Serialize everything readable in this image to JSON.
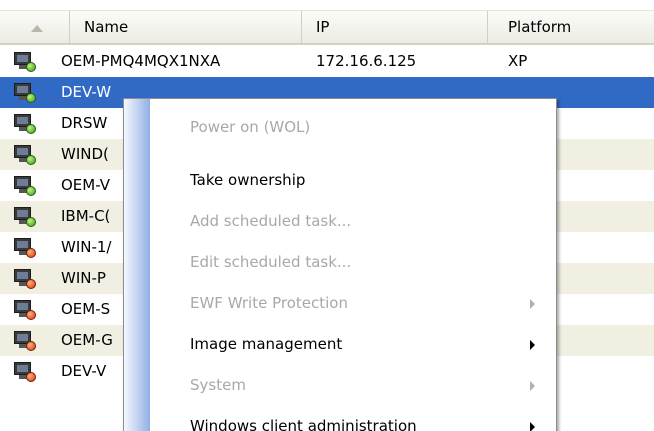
{
  "columns": {
    "name": "Name",
    "ip": "IP",
    "platform": "Platform"
  },
  "rows": [
    {
      "name": "OEM-PMQ4MQX1NXA",
      "ip": "172.16.6.125",
      "platform": "XP",
      "status": "green",
      "selected": false
    },
    {
      "name": "DEV-W",
      "ip": "",
      "platform": "",
      "status": "green",
      "selected": true
    },
    {
      "name": "DRSW",
      "ip": "",
      "platform": "",
      "status": "green",
      "selected": false
    },
    {
      "name": "WIND(",
      "ip": "",
      "platform": "",
      "status": "green",
      "selected": false
    },
    {
      "name": "OEM-V",
      "ip": "",
      "platform": "",
      "status": "green",
      "selected": false
    },
    {
      "name": "IBM-C(",
      "ip": "",
      "platform": "",
      "status": "green",
      "selected": false
    },
    {
      "name": "WIN-1/",
      "ip": "",
      "platform": "",
      "status": "red",
      "selected": false
    },
    {
      "name": "WIN-P",
      "ip": "",
      "platform": "",
      "status": "red",
      "selected": false
    },
    {
      "name": "OEM-S",
      "ip": "",
      "platform": "",
      "status": "red",
      "selected": false
    },
    {
      "name": "OEM-G",
      "ip": "",
      "platform": "",
      "status": "red",
      "selected": false
    },
    {
      "name": "DEV-V",
      "ip": "",
      "platform": "",
      "status": "red",
      "selected": false
    }
  ],
  "context_menu": {
    "items": [
      {
        "label": "Power on (WOL)",
        "disabled": true,
        "submenu": false
      },
      {
        "label": "Take ownership",
        "disabled": false,
        "submenu": false
      },
      {
        "label": "Add scheduled task...",
        "disabled": true,
        "submenu": false
      },
      {
        "label": "Edit scheduled task...",
        "disabled": true,
        "submenu": false
      },
      {
        "label": "EWF Write Protection",
        "disabled": true,
        "submenu": true
      },
      {
        "label": "Image management",
        "disabled": false,
        "submenu": true
      },
      {
        "label": "System",
        "disabled": true,
        "submenu": true
      },
      {
        "label": "Windows client administration",
        "disabled": false,
        "submenu": true
      }
    ]
  },
  "colors": {
    "selection": "#316ac5",
    "alt_row": "#f1efe2",
    "status_online": "#3a9b18",
    "status_offline": "#d33a10",
    "disabled_text": "#a8a8a8"
  }
}
